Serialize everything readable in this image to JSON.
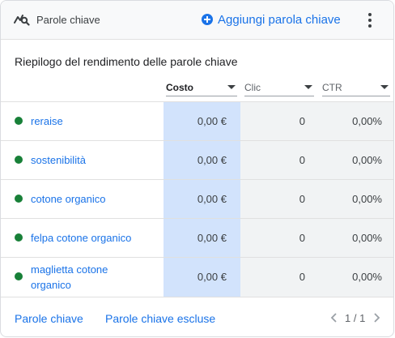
{
  "header": {
    "title": "Parole chiave",
    "add_label": "Aggiungi parola chiave",
    "icons": {
      "title": "keyword-search-icon",
      "add": "plus-circle-icon",
      "more": "more-vert-icon"
    }
  },
  "summary": {
    "title": "Riepilogo del rendimento delle parole chiave"
  },
  "columns": [
    {
      "label": "Costo",
      "active": true
    },
    {
      "label": "Clic",
      "active": false
    },
    {
      "label": "CTR",
      "active": false
    }
  ],
  "rows": [
    {
      "keyword": "reraise",
      "costo": "0,00 €",
      "clic": "0",
      "ctr": "0,00%"
    },
    {
      "keyword": "sostenibilità",
      "costo": "0,00 €",
      "clic": "0",
      "ctr": "0,00%"
    },
    {
      "keyword": "cotone organico",
      "costo": "0,00 €",
      "clic": "0",
      "ctr": "0,00%"
    },
    {
      "keyword": "felpa cotone organico",
      "costo": "0,00 €",
      "clic": "0",
      "ctr": "0,00%"
    },
    {
      "keyword": "maglietta cotone organico",
      "costo": "0,00 €",
      "clic": "0",
      "ctr": "0,00%"
    }
  ],
  "footer": {
    "link1": "Parole chiave",
    "link2": "Parole chiave escluse",
    "pager": "1 / 1"
  },
  "colors": {
    "accent": "#1a73e8",
    "status_enabled": "#188038",
    "active_column": "#d2e3fc",
    "inactive_column": "#f1f3f4"
  }
}
